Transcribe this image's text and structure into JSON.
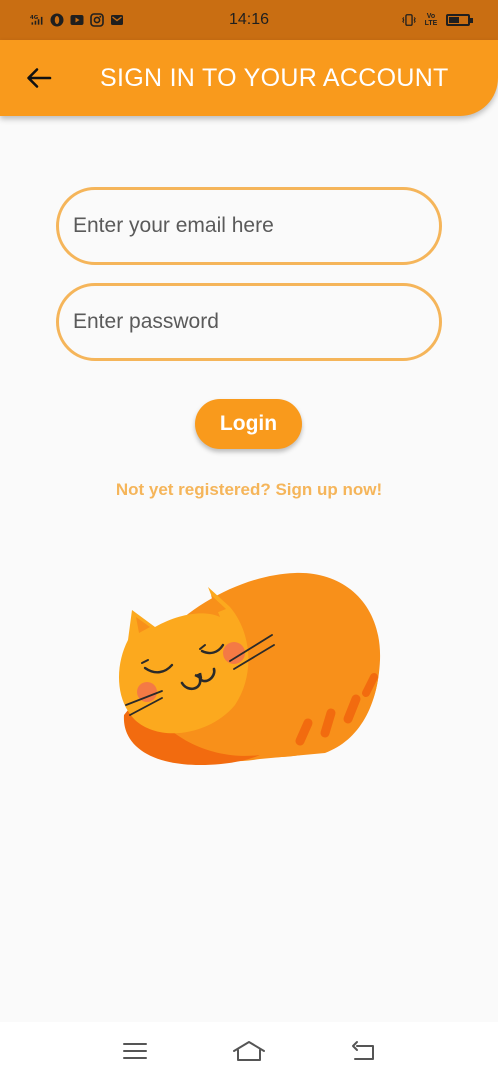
{
  "status_bar": {
    "time": "14:16",
    "network_label": "4G",
    "volte_label": "Vo LTE",
    "battery_level": 0.55,
    "left_icons": [
      "signal-icon",
      "opera-icon",
      "youtube-icon",
      "instagram-icon",
      "mail-icon"
    ],
    "right_icons": [
      "vibrate-icon",
      "volte-icon",
      "battery-icon"
    ]
  },
  "app_bar": {
    "title": "SIGN IN TO YOUR ACCOUNT",
    "back_icon": "arrow-left-icon"
  },
  "form": {
    "email_placeholder": "Enter your email here",
    "email_value": "",
    "password_placeholder": "Enter password",
    "password_value": "",
    "login_label": "Login",
    "signup_text": "Not yet registered? Sign up now!"
  },
  "illustration": "sleeping-cat",
  "nav_bar": {
    "icons": [
      "menu-icon",
      "home-icon",
      "back-icon"
    ]
  },
  "colors": {
    "accent": "#f99a1c",
    "accent_light": "#f5b55a",
    "status_bar": "#c96e12",
    "background": "#fafafa"
  }
}
